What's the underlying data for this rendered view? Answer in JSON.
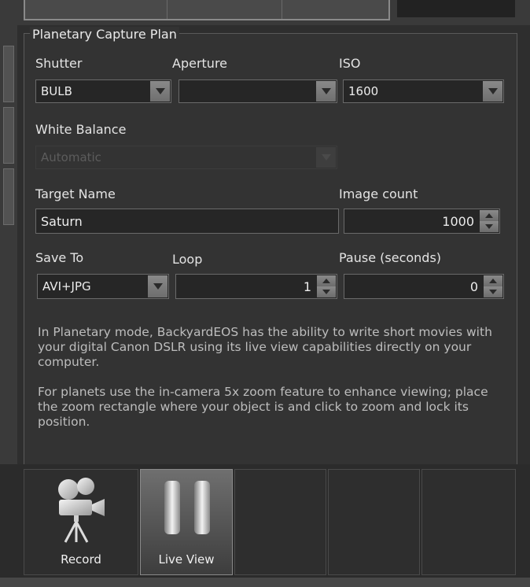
{
  "panel": {
    "title": "Planetary Capture Plan",
    "shutter": {
      "label": "Shutter",
      "value": "BULB"
    },
    "aperture": {
      "label": "Aperture",
      "value": ""
    },
    "iso": {
      "label": "ISO",
      "value": "1600"
    },
    "white_balance": {
      "label": "White Balance",
      "value": "Automatic",
      "disabled": true
    },
    "target_name": {
      "label": "Target Name",
      "value": "Saturn"
    },
    "image_count": {
      "label": "Image count",
      "value": "1000"
    },
    "save_to": {
      "label": "Save To",
      "value": "AVI+JPG"
    },
    "loop": {
      "label": "Loop",
      "value": "1"
    },
    "pause": {
      "label": "Pause (seconds)",
      "value": "0"
    },
    "description": [
      "In Planetary mode, BackyardEOS has the ability to write short movies with your digital Canon DSLR using its live view capabilities directly on your computer.",
      "For planets use the in-camera 5x zoom feature to enhance viewing; place the zoom rectangle where your object is and click to zoom and lock its position."
    ]
  },
  "toolbar": {
    "record": {
      "label": "Record",
      "icon": "movie-camera-icon"
    },
    "live_view": {
      "label": "Live View",
      "icon": "pause-bars-icon",
      "active": true
    }
  }
}
